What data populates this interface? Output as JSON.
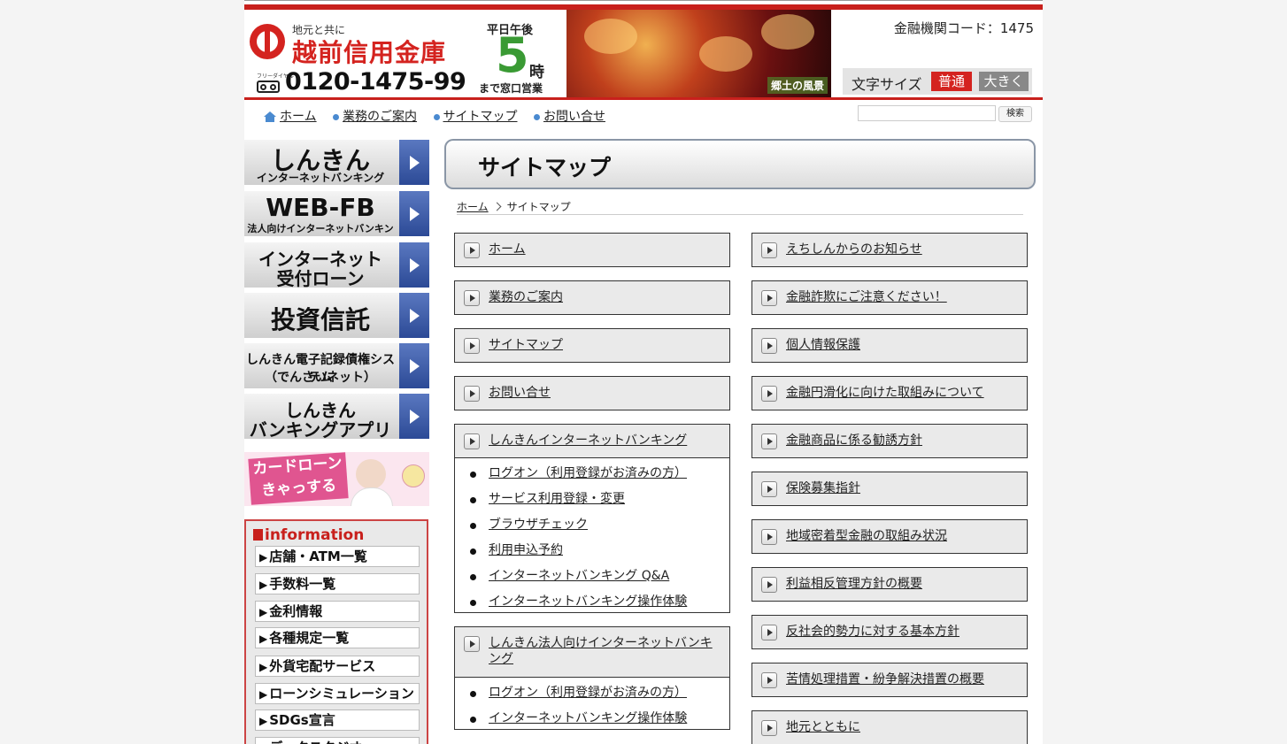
{
  "header": {
    "logo_sub": "地元と共に",
    "logo_name": "越前信用金庫",
    "free_dial_label": "フリーダイヤル",
    "phone": "0120-1475-99",
    "hours_top": "平日午後",
    "hours_num": "5",
    "hours_unit": "時",
    "hours_bottom": "まで窓口営業",
    "banner_caption": "郷土の風景",
    "bank_code": "金融機関コード：1475",
    "font_size_label": "文字サイズ",
    "font_size_normal": "普通",
    "font_size_large": "大きく"
  },
  "nav": {
    "home": "ホーム",
    "business": "業務のご案内",
    "sitemap": "サイトマップ",
    "contact": "お問い合せ",
    "search_button": "検索"
  },
  "sidebar": {
    "banners": [
      {
        "line1": "しんきん",
        "line2": "インターネットバンキング"
      },
      {
        "line1": "WEB-FB",
        "line2": "法人向けインターネットバンキング"
      },
      {
        "line1": "インターネット",
        "line2": "受付ローン"
      },
      {
        "line1": "投資信託",
        "line2": ""
      },
      {
        "line1": "しんきん電子記録債権システム",
        "line2": "（でんさいネット）"
      },
      {
        "line1": "しんきん",
        "line2": "バンキングアプリ"
      }
    ],
    "cardloan": "カードローン きゃっする",
    "info_title": "information",
    "info_links": [
      "店舗・ATM一覧",
      "手数料一覧",
      "金利情報",
      "各種規定一覧",
      "外貨宅配サービス",
      "ローンシミュレーション",
      "SDGs宣言",
      "データスタジオ"
    ]
  },
  "main": {
    "title": "サイトマップ",
    "breadcrumb_home": "ホーム",
    "breadcrumb_current": "サイトマップ",
    "left_col": [
      "ホーム",
      "業務のご案内",
      "サイトマップ",
      "お問い合せ",
      "しんきんインターネットバンキング",
      "しんきん法人向けインターネットバンキング"
    ],
    "ib_sub": [
      "ログオン（利用登録がお済みの方）",
      "サービス利用登録・変更",
      "ブラウザチェック",
      "利用申込予約",
      "インターネットバンキング Q&A",
      "インターネットバンキング操作体験"
    ],
    "corp_sub": [
      "ログオン（利用登録がお済みの方）",
      "インターネットバンキング操作体験"
    ],
    "right_col": [
      "えちしんからのお知らせ",
      "金融詐欺にご注意ください！",
      "個人情報保護",
      "金融円滑化に向けた取組みについて",
      "金融商品に係る勧誘方針",
      "保険募集指針",
      "地域密着型金融の取組み状況",
      "利益相反管理方針の概要",
      "反社会的勢力に対する基本方針",
      "苦情処理措置・紛争解決措置の概要",
      "地元とともに"
    ]
  }
}
